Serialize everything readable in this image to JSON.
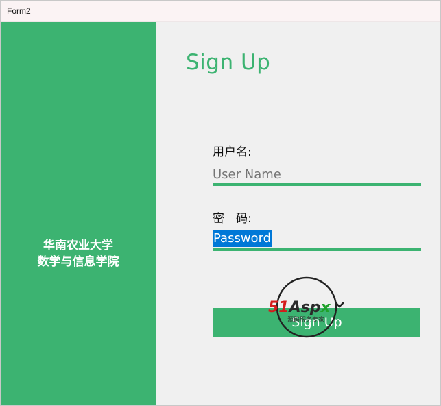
{
  "window": {
    "title": "Form2"
  },
  "sidebar": {
    "line1": "华南农业大学",
    "line2": "数学与信息学院"
  },
  "form": {
    "heading": "Sign Up",
    "username_label": "用户名:",
    "username_placeholder": "User Name",
    "password_label": "密　码:",
    "password_value": "Password",
    "submit_label": "Sign Up"
  },
  "watermark": {
    "brand": "51Aspx",
    "tagline": "源码服务专家"
  },
  "colors": {
    "accent": "#3cb371",
    "selection": "#0078d7",
    "background": "#f0f0f0"
  }
}
